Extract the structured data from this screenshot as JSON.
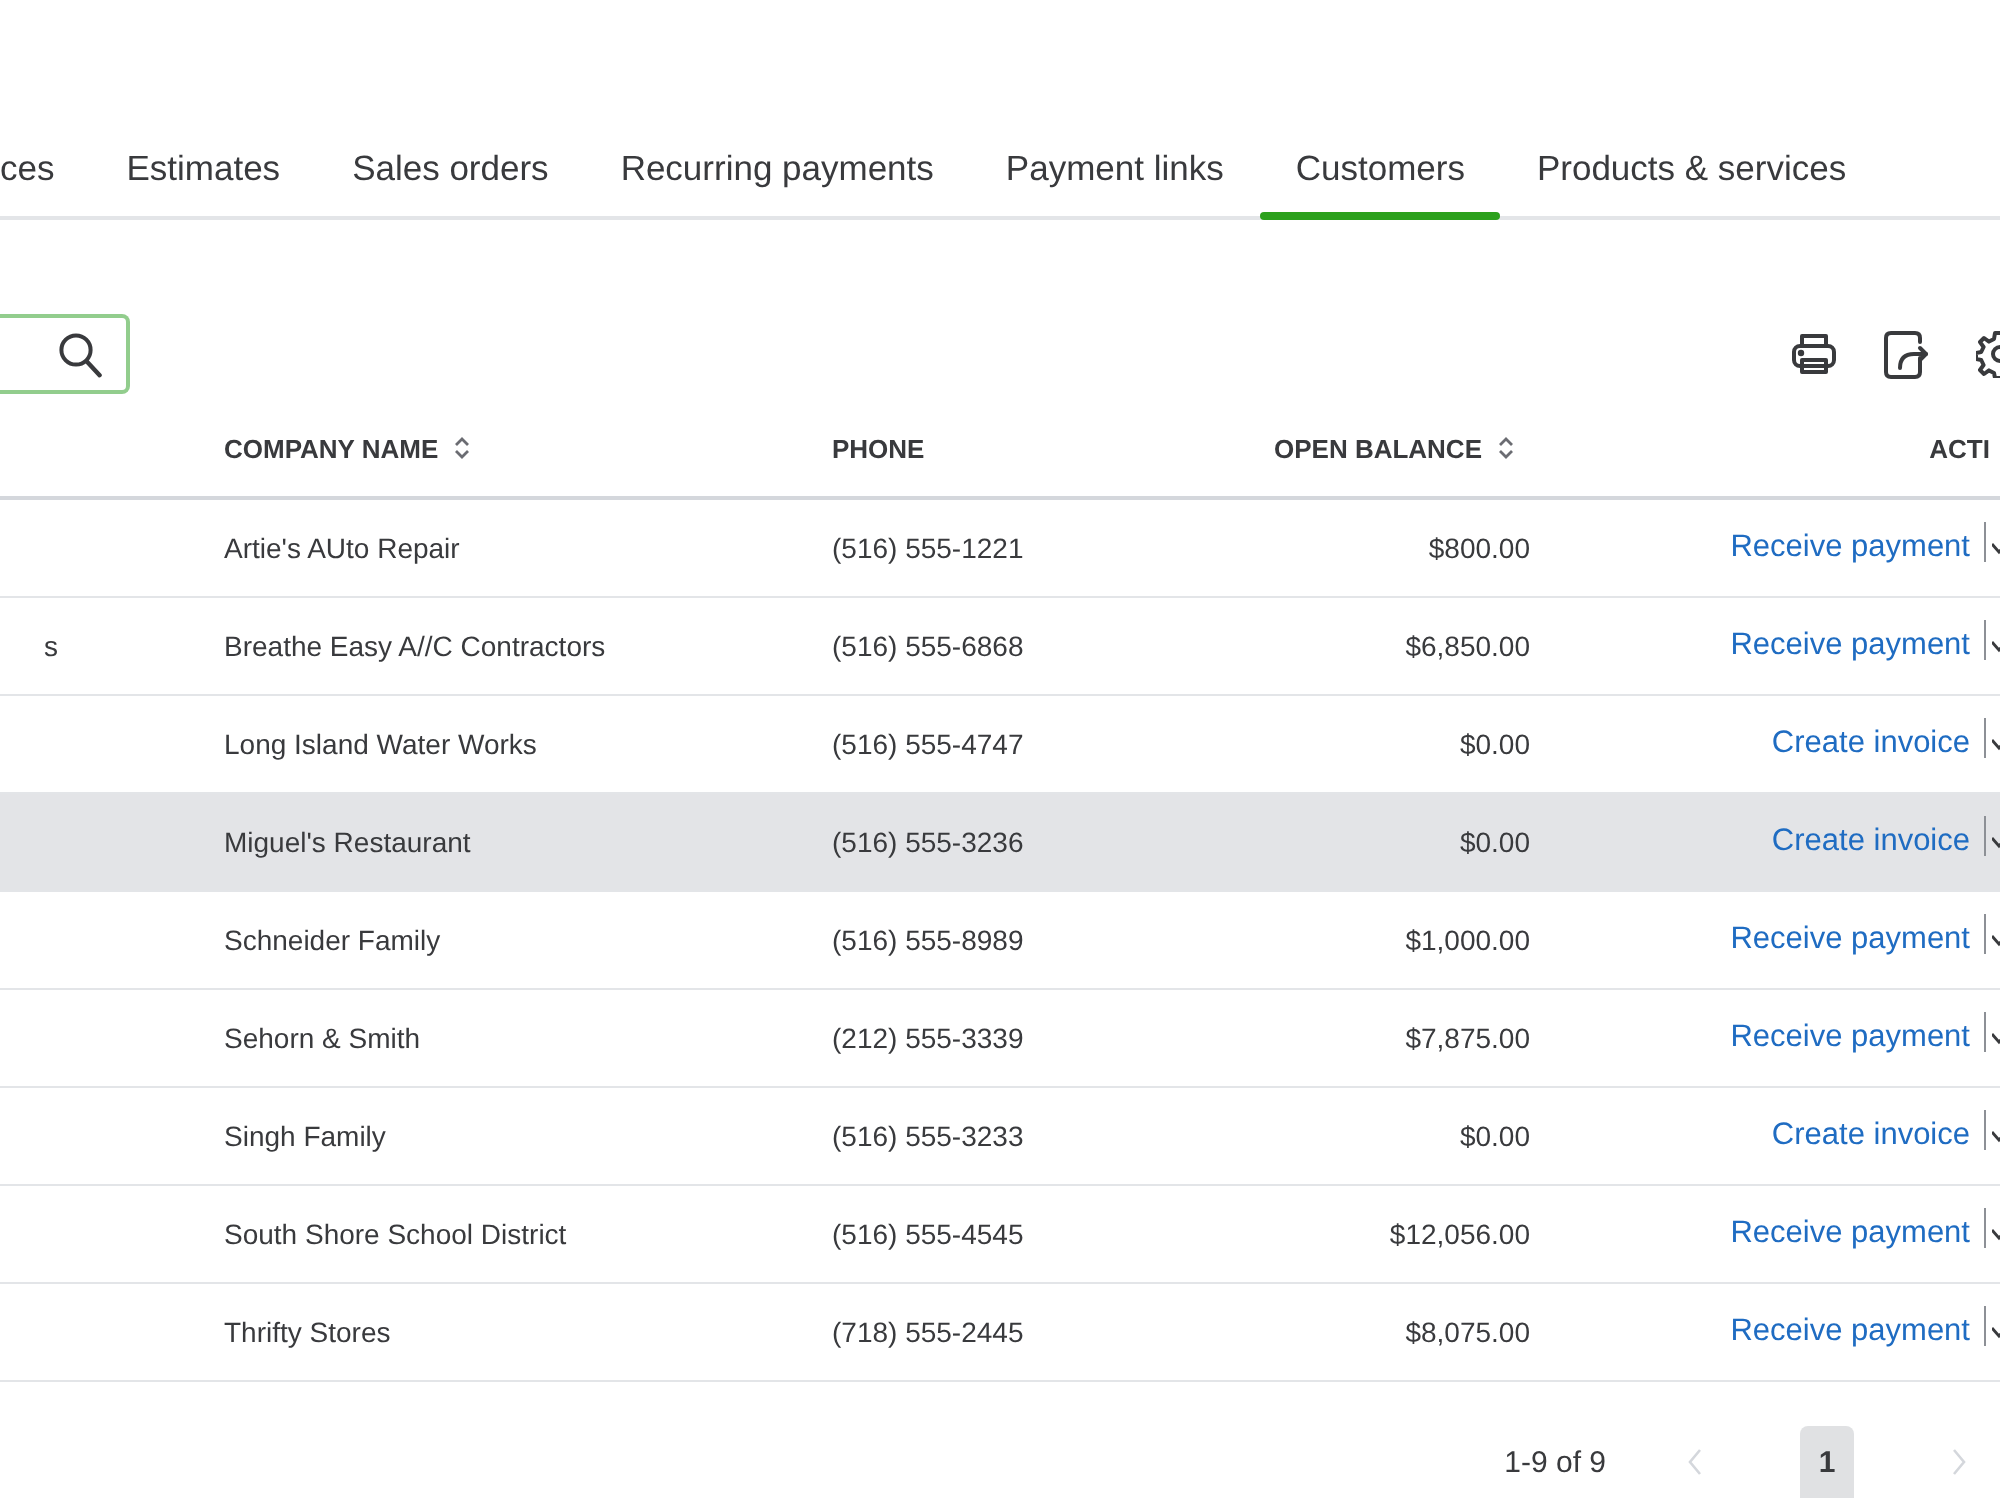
{
  "tabs": [
    {
      "label": "ces",
      "selected": false
    },
    {
      "label": "Estimates",
      "selected": false
    },
    {
      "label": "Sales orders",
      "selected": false
    },
    {
      "label": "Recurring payments",
      "selected": false
    },
    {
      "label": "Payment links",
      "selected": false
    },
    {
      "label": "Customers",
      "selected": true
    },
    {
      "label": "Products & services",
      "selected": false
    }
  ],
  "search": {
    "focused": true
  },
  "table": {
    "columns": [
      {
        "label": "COMPANY NAME",
        "sortable": true
      },
      {
        "label": "PHONE",
        "sortable": false
      },
      {
        "label": "OPEN BALANCE",
        "sortable": true
      },
      {
        "label": "ACTI",
        "sortable": false
      }
    ],
    "rows": [
      {
        "company": "Artie's AUto Repair",
        "phone": "(516) 555-1221",
        "balance": "$800.00",
        "action": "Receive payment",
        "highlighted": false
      },
      {
        "column_1": "s",
        "company": "Breathe Easy A//C Contractors",
        "phone": "(516) 555-6868",
        "balance": "$6,850.00",
        "action": "Receive payment",
        "highlighted": false
      },
      {
        "company": "Long Island Water Works",
        "phone": "(516) 555-4747",
        "balance": "$0.00",
        "action": "Create invoice",
        "highlighted": false
      },
      {
        "company": "Miguel's Restaurant",
        "phone": "(516) 555-3236",
        "balance": "$0.00",
        "action": "Create invoice",
        "highlighted": true
      },
      {
        "company": "Schneider Family",
        "phone": "(516) 555-8989",
        "balance": "$1,000.00",
        "action": "Receive payment",
        "highlighted": false
      },
      {
        "company": "Sehorn & Smith",
        "phone": "(212) 555-3339",
        "balance": "$7,875.00",
        "action": "Receive payment",
        "highlighted": false
      },
      {
        "company": "Singh Family",
        "phone": "(516) 555-3233",
        "balance": "$0.00",
        "action": "Create invoice",
        "highlighted": false
      },
      {
        "company": "South Shore School District",
        "phone": "(516) 555-4545",
        "balance": "$12,056.00",
        "action": "Receive payment",
        "highlighted": false
      },
      {
        "company": "Thrifty Stores",
        "phone": "(718) 555-2445",
        "balance": "$8,075.00",
        "action": "Receive payment",
        "highlighted": false
      }
    ]
  },
  "pagination": {
    "range": "1-9 of 9",
    "prev": {
      "disabled": true
    },
    "pages": [
      {
        "label": "1",
        "selected": true
      }
    ],
    "next": {
      "disabled": true
    }
  }
}
